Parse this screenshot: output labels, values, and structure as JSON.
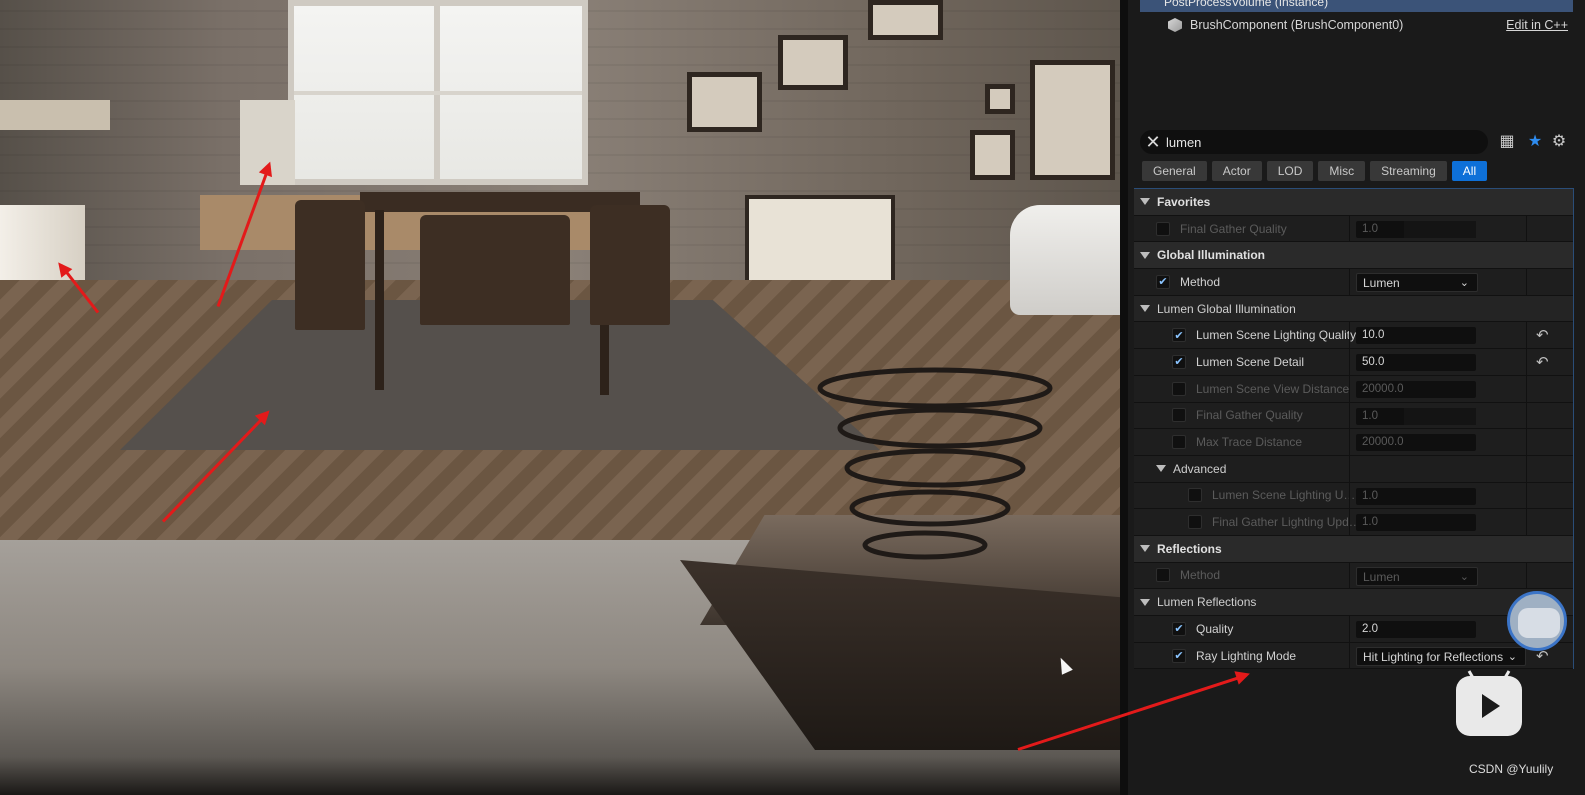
{
  "components": {
    "selected": "PostProcessVolume (Instance)",
    "brush": "BrushComponent (BrushComponent0)",
    "edit_link": "Edit in C++"
  },
  "search": {
    "value": "lumen"
  },
  "toolbar": {
    "icons": [
      "table-view-icon",
      "favorite-star-icon",
      "settings-gear-icon"
    ]
  },
  "tabs": [
    "General",
    "Actor",
    "LOD",
    "Misc",
    "Streaming",
    "All"
  ],
  "active_tab": "All",
  "sections": {
    "favorites": {
      "title": "Favorites",
      "final_gather_quality": {
        "label": "Final Gather Quality",
        "value": "1.0"
      }
    },
    "global_illumination": {
      "title": "Global Illumination",
      "method": {
        "label": "Method",
        "value": "Lumen"
      }
    },
    "lumen_gi": {
      "title": "Lumen Global Illumination",
      "scene_lighting_quality": {
        "label": "Lumen Scene Lighting Quality",
        "value": "10.0"
      },
      "scene_detail": {
        "label": "Lumen Scene Detail",
        "value": "50.0"
      },
      "scene_view_distance": {
        "label": "Lumen Scene View Distance",
        "value": "20000.0"
      },
      "final_gather_quality": {
        "label": "Final Gather Quality",
        "value": "1.0"
      },
      "max_trace_distance": {
        "label": "Max Trace Distance",
        "value": "20000.0"
      }
    },
    "advanced": {
      "title": "Advanced",
      "scene_lighting_update": {
        "label": "Lumen Scene Lighting Upd...",
        "value": "1.0"
      },
      "final_gather_lighting_update": {
        "label": "Final Gather Lighting Updat...",
        "value": "1.0"
      }
    },
    "reflections": {
      "title": "Reflections",
      "method": {
        "label": "Method",
        "value": "Lumen"
      }
    },
    "lumen_reflections": {
      "title": "Lumen Reflections",
      "quality": {
        "label": "Quality",
        "value": "2.0"
      },
      "ray_lighting_mode": {
        "label": "Ray Lighting Mode",
        "value": "Hit Lighting for Reflections"
      }
    }
  },
  "watermark": "CSDN @Yuulily"
}
